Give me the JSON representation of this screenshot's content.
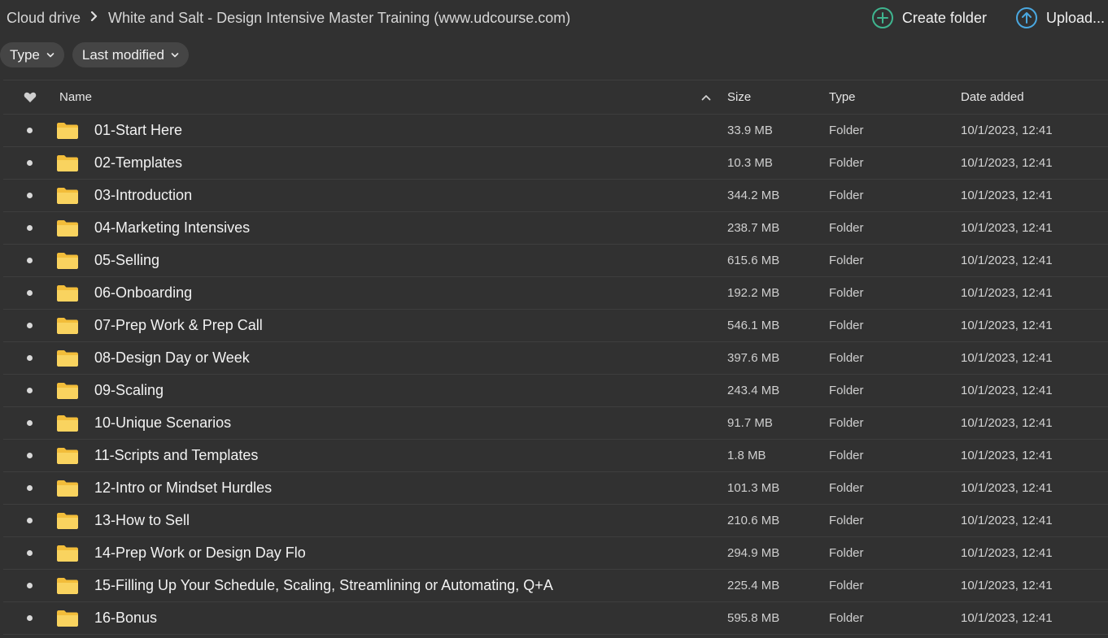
{
  "breadcrumb": {
    "root": "Cloud drive",
    "current": "White and Salt - Design Intensive Master Training (www.udcourse.com)"
  },
  "actions": {
    "create_folder": "Create folder",
    "upload": "Upload..."
  },
  "filters": {
    "type": "Type",
    "last_modified": "Last modified"
  },
  "columns": {
    "name": "Name",
    "size": "Size",
    "type": "Type",
    "date_added": "Date added"
  },
  "colors": {
    "background": "#313131",
    "accent_green": "#3fb58f",
    "accent_blue": "#4aa8e0",
    "folder_yellow": "#f7c948"
  },
  "rows": [
    {
      "name": "01-Start Here",
      "size": "33.9 MB",
      "type": "Folder",
      "date": "10/1/2023, 12:41"
    },
    {
      "name": "02-Templates",
      "size": "10.3 MB",
      "type": "Folder",
      "date": "10/1/2023, 12:41"
    },
    {
      "name": "03-Introduction",
      "size": "344.2 MB",
      "type": "Folder",
      "date": "10/1/2023, 12:41"
    },
    {
      "name": "04-Marketing Intensives",
      "size": "238.7 MB",
      "type": "Folder",
      "date": "10/1/2023, 12:41"
    },
    {
      "name": "05-Selling",
      "size": "615.6 MB",
      "type": "Folder",
      "date": "10/1/2023, 12:41"
    },
    {
      "name": "06-Onboarding",
      "size": "192.2 MB",
      "type": "Folder",
      "date": "10/1/2023, 12:41"
    },
    {
      "name": "07-Prep Work & Prep Call",
      "size": "546.1 MB",
      "type": "Folder",
      "date": "10/1/2023, 12:41"
    },
    {
      "name": "08-Design Day or Week",
      "size": "397.6 MB",
      "type": "Folder",
      "date": "10/1/2023, 12:41"
    },
    {
      "name": "09-Scaling",
      "size": "243.4 MB",
      "type": "Folder",
      "date": "10/1/2023, 12:41"
    },
    {
      "name": "10-Unique Scenarios",
      "size": "91.7 MB",
      "type": "Folder",
      "date": "10/1/2023, 12:41"
    },
    {
      "name": "11-Scripts and Templates",
      "size": "1.8 MB",
      "type": "Folder",
      "date": "10/1/2023, 12:41"
    },
    {
      "name": "12-Intro or Mindset Hurdles",
      "size": "101.3 MB",
      "type": "Folder",
      "date": "10/1/2023, 12:41"
    },
    {
      "name": "13-How to Sell",
      "size": "210.6 MB",
      "type": "Folder",
      "date": "10/1/2023, 12:41"
    },
    {
      "name": "14-Prep Work or Design Day Flo",
      "size": "294.9 MB",
      "type": "Folder",
      "date": "10/1/2023, 12:41"
    },
    {
      "name": "15-Filling Up Your Schedule, Scaling, Streamlining or Automating, Q+A",
      "size": "225.4 MB",
      "type": "Folder",
      "date": "10/1/2023, 12:41"
    },
    {
      "name": "16-Bonus",
      "size": "595.8 MB",
      "type": "Folder",
      "date": "10/1/2023, 12:41"
    }
  ]
}
